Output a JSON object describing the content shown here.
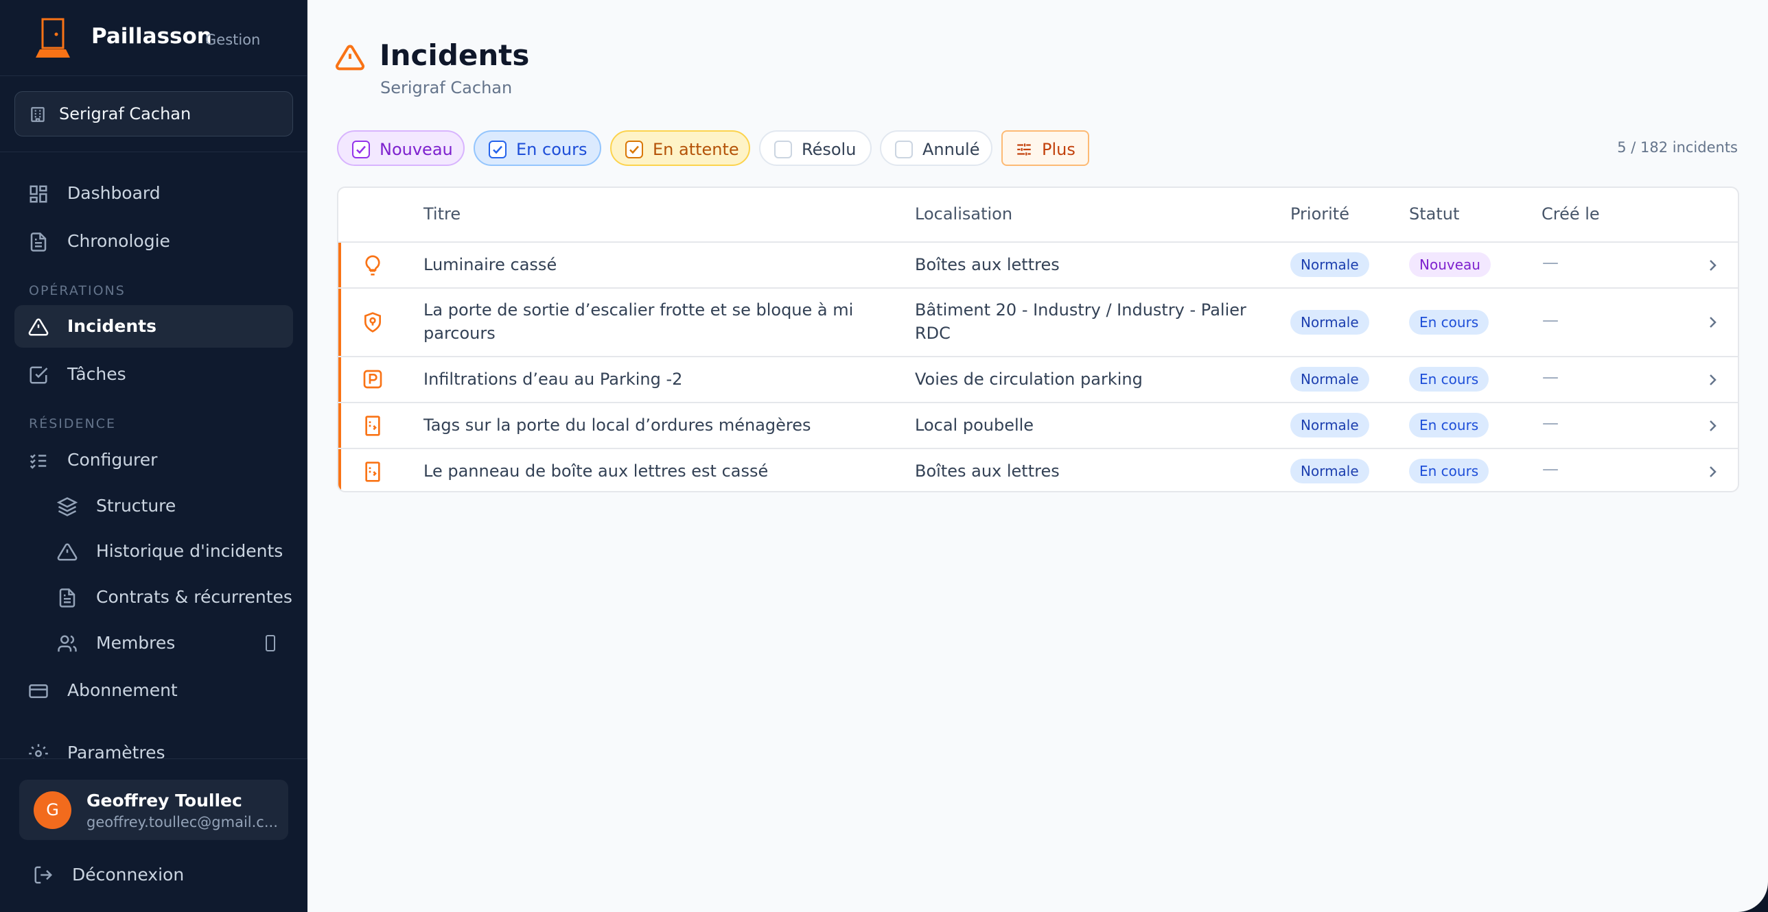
{
  "app": {
    "name": "Paillasson",
    "subtitle": "Gestion"
  },
  "sidebar": {
    "org_selector": "Serigraf Cachan",
    "nav_top": [
      {
        "label": "Dashboard",
        "icon": "dashboard-icon"
      },
      {
        "label": "Chronologie",
        "icon": "document-icon"
      }
    ],
    "section_operations": "OPÉRATIONS",
    "nav_operations": [
      {
        "label": "Incidents",
        "icon": "warning-icon",
        "active": true
      },
      {
        "label": "Tâches",
        "icon": "checkbox-icon"
      }
    ],
    "section_residence": "RÉSIDENCE",
    "nav_residence": {
      "configurer": "Configurer",
      "structure": "Structure",
      "historique": "Historique d'incidents",
      "contrats": "Contrats & récurrentes",
      "membres": "Membres",
      "abonnement": "Abonnement",
      "parametres": "Paramètres"
    },
    "user": {
      "initial": "G",
      "name": "Geoffrey Toullec",
      "email": "geoffrey.toullec@gmail.c..."
    },
    "logout": "Déconnexion"
  },
  "page": {
    "title": "Incidents",
    "subtitle": "Serigraf Cachan"
  },
  "filters": {
    "nouveau": {
      "label": "Nouveau",
      "checked": true
    },
    "en_cours": {
      "label": "En cours",
      "checked": true
    },
    "en_attente": {
      "label": "En attente",
      "checked": true
    },
    "resolu": {
      "label": "Résolu",
      "checked": false
    },
    "annule": {
      "label": "Annulé",
      "checked": false
    },
    "more": "Plus",
    "count": "5 / 182 incidents"
  },
  "table": {
    "columns": {
      "titre": "Titre",
      "localisation": "Localisation",
      "priorite": "Priorité",
      "statut": "Statut",
      "cree_le": "Créé le"
    },
    "rows": [
      {
        "icon": "lightbulb-icon",
        "title": "Luminaire cassé",
        "location": "Boîtes aux lettres",
        "priority": "Normale",
        "status": "Nouveau",
        "created": "—"
      },
      {
        "icon": "shield-location-icon",
        "title": "La porte de sortie d’escalier frotte et se bloque à mi parcours",
        "location": "Bâtiment 20 - Industry / Industry - Palier RDC",
        "priority": "Normale",
        "status": "En cours",
        "created": "—"
      },
      {
        "icon": "parking-icon",
        "title": "Infiltrations d’eau au Parking -2",
        "location": "Voies de circulation parking",
        "priority": "Normale",
        "status": "En cours",
        "created": "—"
      },
      {
        "icon": "door-icon",
        "title": "Tags sur la porte du local d’ordures ménagères",
        "location": "Local poubelle",
        "priority": "Normale",
        "status": "En cours",
        "created": "—"
      },
      {
        "icon": "door-icon",
        "title": "Le panneau de boîte aux lettres est cassé",
        "location": "Boîtes aux lettres",
        "priority": "Normale",
        "status": "En cours",
        "created": "—"
      }
    ]
  },
  "colors": {
    "accent": "#f97316",
    "sidebar_bg": "#0f1a2e",
    "status_nouveau": "#7e22ce",
    "status_en_cours": "#1d4ed8"
  }
}
